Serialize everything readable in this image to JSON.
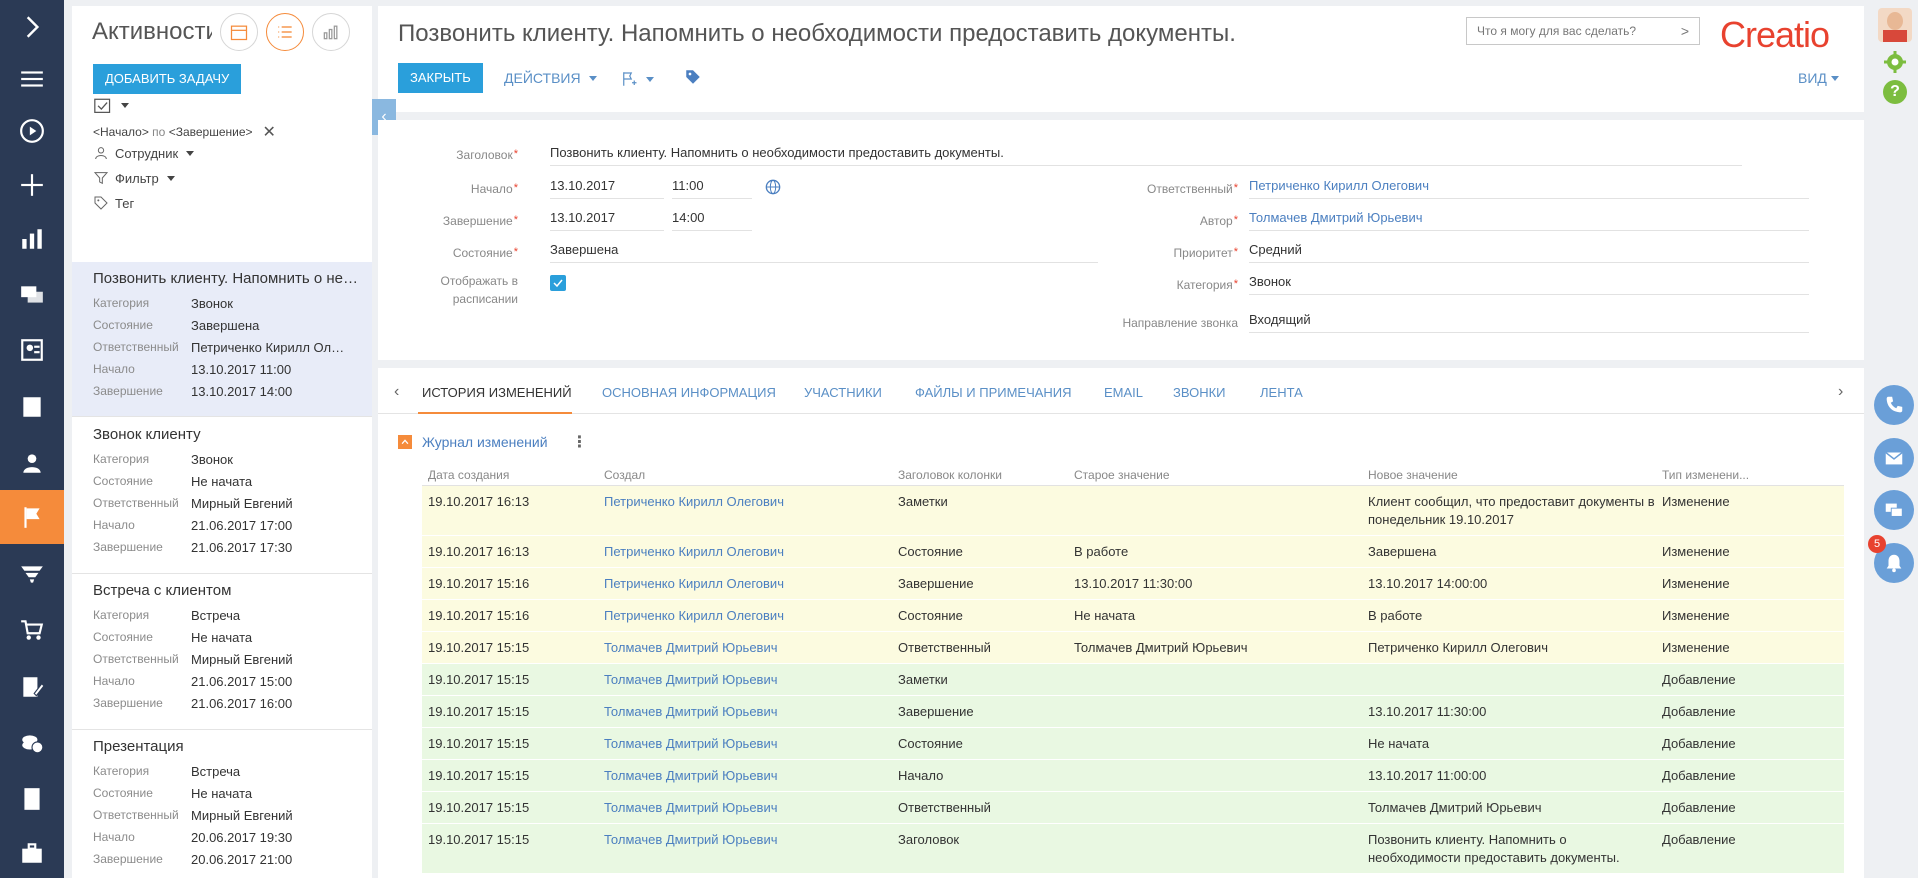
{
  "app": {
    "logo": "Creatio",
    "accent": "#2a9fdb",
    "brand": "#e8422f",
    "active_nav": "#f58b3b"
  },
  "rail": {
    "items": [
      "chevron-right-icon",
      "hamburger-icon",
      "play-icon",
      "plus-icon",
      "chart-icon",
      "chat-icon",
      "contacts-icon",
      "accounts-icon",
      "person-icon",
      "flag-icon",
      "funnel-icon",
      "cart-icon",
      "document-edit-icon",
      "coins-icon",
      "document-icon",
      "briefcase-icon"
    ]
  },
  "list_panel": {
    "title": "Активности",
    "add_task": "ДОБАВИТЬ ЗАДАЧУ",
    "period_start": "<Начало>",
    "period_sep": "по",
    "period_end": "<Завершение>",
    "employee": "Сотрудник",
    "filter": "Фильтр",
    "tag": "Тег",
    "cards": [
      {
        "title": "Позвонить клиенту. Напомнить о необходимости предоставить документы.",
        "category_label": "Категория",
        "category": "Звонок",
        "state_label": "Состояние",
        "state": "Завершена",
        "owner_label": "Ответственный",
        "owner": "Петриченко Кирилл Олегович",
        "start_label": "Начало",
        "start": "13.10.2017 11:00",
        "end_label": "Завершение",
        "end": "13.10.2017 14:00"
      },
      {
        "title": "Звонок клиенту",
        "category_label": "Категория",
        "category": "Звонок",
        "state_label": "Состояние",
        "state": "Не начата",
        "owner_label": "Ответственный",
        "owner": "Мирный Евгений",
        "start_label": "Начало",
        "start": "21.06.2017 17:00",
        "end_label": "Завершение",
        "end": "21.06.2017 17:30"
      },
      {
        "title": "Встреча с клиентом",
        "category_label": "Категория",
        "category": "Встреча",
        "state_label": "Состояние",
        "state": "Не начата",
        "owner_label": "Ответственный",
        "owner": "Мирный Евгений",
        "start_label": "Начало",
        "start": "21.06.2017 15:00",
        "end_label": "Завершение",
        "end": "21.06.2017 16:00"
      },
      {
        "title": "Презентация",
        "category_label": "Категория",
        "category": "Встреча",
        "state_label": "Состояние",
        "state": "Не начата",
        "owner_label": "Ответственный",
        "owner": "Мирный Евгений",
        "start_label": "Начало",
        "start": "20.06.2017 19:30",
        "end_label": "Завершение",
        "end": "20.06.2017 21:00"
      }
    ]
  },
  "header": {
    "title": "Позвонить клиенту. Напомнить о необходимости предоставить документы.",
    "close": "ЗАКРЫТЬ",
    "actions": "ДЕЙСТВИЯ",
    "search_placeholder": "Что я могу для вас сделать?",
    "view": "ВИД"
  },
  "float_buttons": {
    "notifications_count": "5"
  },
  "form": {
    "subject_label": "Заголовок",
    "subject": "Позвонить клиенту. Напомнить о необходимости предоставить документы.",
    "start_label": "Начало",
    "start_date": "13.10.2017",
    "start_time": "11:00",
    "end_label": "Завершение",
    "end_date": "13.10.2017",
    "end_time": "14:00",
    "state_label": "Состояние",
    "state": "Завершена",
    "show_label_1": "Отображать в",
    "show_label_2": "расписании",
    "owner_label": "Ответственный",
    "owner": "Петриченко Кирилл Олегович",
    "author_label": "Автор",
    "author": "Толмачев Дмитрий Юрьевич",
    "priority_label": "Приоритет",
    "priority": "Средний",
    "category_label": "Категория",
    "category": "Звонок",
    "direction_label": "Направление звонка",
    "direction": "Входящий"
  },
  "tabs": [
    "ИСТОРИЯ ИЗМЕНЕНИЙ",
    "ОСНОВНАЯ ИНФОРМАЦИЯ",
    "УЧАСТНИКИ",
    "ФАЙЛЫ И ПРИМЕЧАНИЯ",
    "EMAIL",
    "ЗВОНКИ",
    "ЛЕНТА"
  ],
  "log": {
    "title": "Журнал изменений",
    "columns": [
      "Дата создания",
      "Создал",
      "Заголовок колонки",
      "Старое значение",
      "Новое значение",
      "Тип изменени..."
    ],
    "rows": [
      {
        "kind": "yellow",
        "cells": [
          "19.10.2017 16:13",
          "Петриченко Кирилл Олегович",
          "Заметки",
          "",
          "Клиент сообщил, что предоставит документы в понедельник 19.10.2017",
          "Изменение"
        ]
      },
      {
        "kind": "yellow",
        "cells": [
          "19.10.2017 16:13",
          "Петриченко Кирилл Олегович",
          "Состояние",
          "В работе",
          "Завершена",
          "Изменение"
        ]
      },
      {
        "kind": "yellow",
        "cells": [
          "19.10.2017 15:16",
          "Петриченко Кирилл Олегович",
          "Завершение",
          "13.10.2017 11:30:00",
          "13.10.2017 14:00:00",
          "Изменение"
        ]
      },
      {
        "kind": "yellow",
        "cells": [
          "19.10.2017 15:16",
          "Петриченко Кирилл Олегович",
          "Состояние",
          "Не начата",
          "В работе",
          "Изменение"
        ]
      },
      {
        "kind": "yellow",
        "cells": [
          "19.10.2017 15:15",
          "Толмачев Дмитрий Юрьевич",
          "Ответственный",
          "Толмачев Дмитрий Юрьевич",
          "Петриченко Кирилл Олегович",
          "Изменение"
        ]
      },
      {
        "kind": "green",
        "cells": [
          "19.10.2017 15:15",
          "Толмачев Дмитрий Юрьевич",
          "Заметки",
          "",
          "",
          "Добавление"
        ]
      },
      {
        "kind": "green",
        "cells": [
          "19.10.2017 15:15",
          "Толмачев Дмитрий Юрьевич",
          "Завершение",
          "",
          "13.10.2017 11:30:00",
          "Добавление"
        ]
      },
      {
        "kind": "green",
        "cells": [
          "19.10.2017 15:15",
          "Толмачев Дмитрий Юрьевич",
          "Состояние",
          "",
          "Не начата",
          "Добавление"
        ]
      },
      {
        "kind": "green",
        "cells": [
          "19.10.2017 15:15",
          "Толмачев Дмитрий Юрьевич",
          "Начало",
          "",
          "13.10.2017 11:00:00",
          "Добавление"
        ]
      },
      {
        "kind": "green",
        "cells": [
          "19.10.2017 15:15",
          "Толмачев Дмитрий Юрьевич",
          "Ответственный",
          "",
          "Толмачев Дмитрий Юрьевич",
          "Добавление"
        ]
      },
      {
        "kind": "green",
        "cells": [
          "19.10.2017 15:15",
          "Толмачев Дмитрий Юрьевич",
          "Заголовок",
          "",
          "Позвонить клиенту. Напомнить о необходимости предоставить документы.",
          "Добавление"
        ]
      }
    ]
  }
}
